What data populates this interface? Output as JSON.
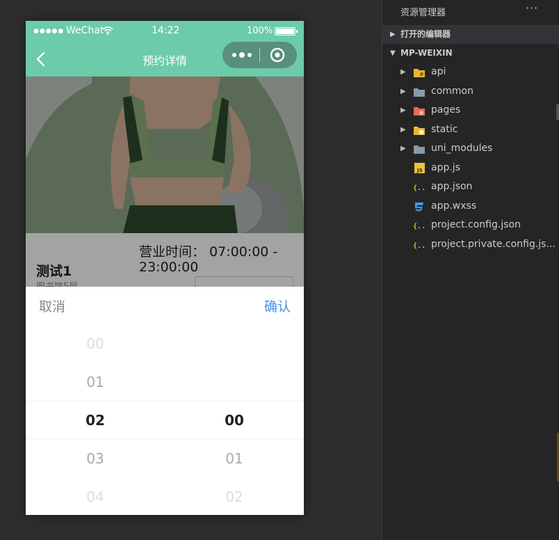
{
  "status_bar": {
    "carrier": "WeChat",
    "time": "14:22",
    "battery": "100%"
  },
  "nav": {
    "title": "预约详情",
    "back_icon": "chevron-left-icon",
    "more_icon": "more-dots-icon",
    "close_icon": "target-circle-icon"
  },
  "colors": {
    "nav_bg": "#6ccba9",
    "confirm": "#4a90e2"
  },
  "shop": {
    "name": "测试1",
    "location": "图书馆5层",
    "hours_label": "营业时间：  07:00:00 -",
    "hours_value": "23:00:00",
    "field_label": "   "
  },
  "picker": {
    "cancel": "取消",
    "confirm": "确认",
    "hours": [
      "00",
      "01",
      "02",
      "03",
      "04"
    ],
    "minutes": [
      "",
      "",
      "00",
      "01",
      "02"
    ],
    "selected_hour": "02",
    "selected_minute": "00"
  },
  "explorer": {
    "title": "资源管理器",
    "more_icon": "ellipsis-icon",
    "sections": {
      "open_editors": "打开的编辑器",
      "project": "MP-WEIXIN"
    },
    "items": [
      {
        "label": "api",
        "type": "folder",
        "icon": "api-folder-icon"
      },
      {
        "label": "common",
        "type": "folder",
        "icon": "folder-icon"
      },
      {
        "label": "pages",
        "type": "folder",
        "icon": "pages-folder-icon"
      },
      {
        "label": "static",
        "type": "folder",
        "icon": "static-folder-icon"
      },
      {
        "label": "uni_modules",
        "type": "folder",
        "icon": "folder-icon"
      },
      {
        "label": "app.js",
        "type": "file",
        "icon": "js-file-icon"
      },
      {
        "label": "app.json",
        "type": "file",
        "icon": "json-file-icon"
      },
      {
        "label": "app.wxss",
        "type": "file",
        "icon": "css-file-icon"
      },
      {
        "label": "project.config.json",
        "type": "file",
        "icon": "json-file-icon"
      },
      {
        "label": "project.private.config.js...",
        "type": "file",
        "icon": "json-file-icon"
      }
    ]
  }
}
